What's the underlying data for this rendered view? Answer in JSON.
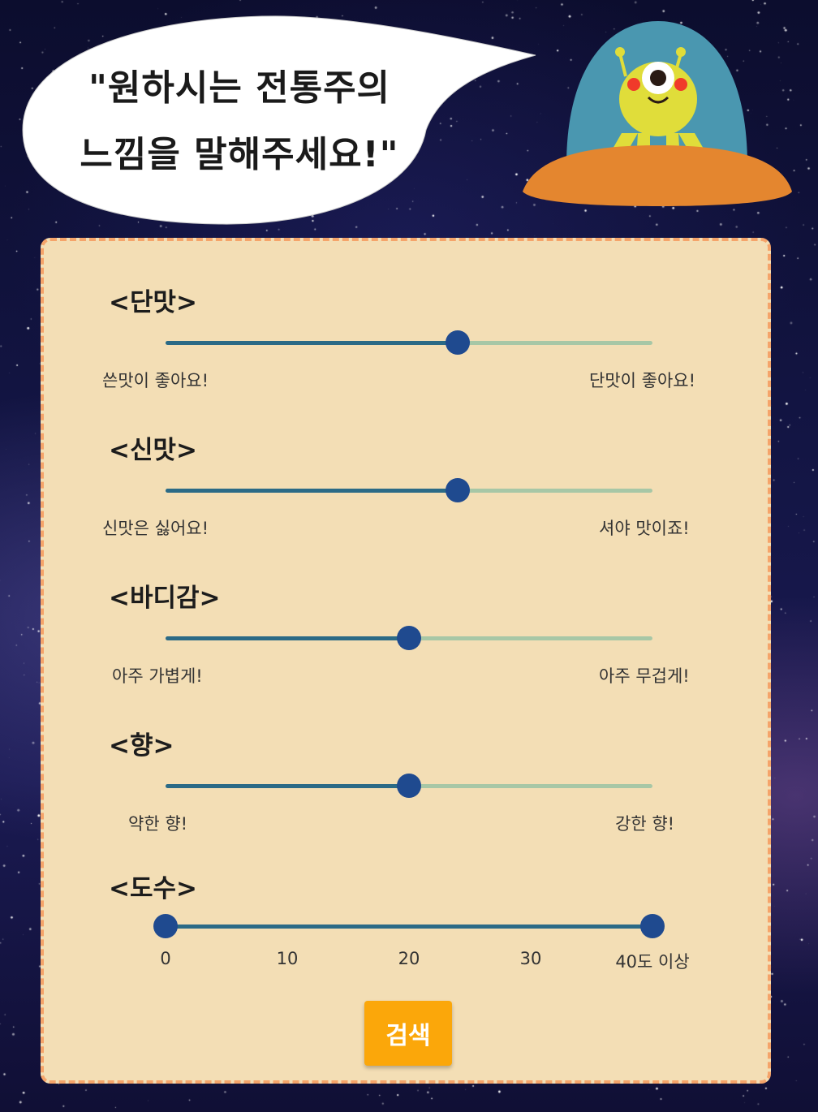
{
  "speech": {
    "line1": "\"원하시는 전통주의",
    "line2": "느낌을 말해주세요!\""
  },
  "sliders": [
    {
      "title": "<단맛>",
      "left_label": "쓴맛이 좋아요!",
      "right_label": "단맛이 좋아요!",
      "value": 0.6
    },
    {
      "title": "<신맛>",
      "left_label": "신맛은 싫어요!",
      "right_label": "셔야 맛이죠!",
      "value": 0.6
    },
    {
      "title": "<바디감>",
      "left_label": "아주 가볍게!",
      "right_label": "아주 무겁게!",
      "value": 0.5
    },
    {
      "title": "<향>",
      "left_label": "약한 향!",
      "right_label": "강한 향!",
      "value": 0.5
    }
  ],
  "abv": {
    "title": "<도수>",
    "range": [
      0,
      40
    ],
    "ticks": [
      "0",
      "10",
      "20",
      "30",
      "40도 이상"
    ]
  },
  "search_label": "검색",
  "colors": {
    "panel": "#f3deb5",
    "panel_border": "#f5a46a",
    "track_fill": "#2b6a86",
    "track_rest": "#a7c7a6",
    "thumb": "#1f4a8f",
    "button": "#fba70a"
  }
}
